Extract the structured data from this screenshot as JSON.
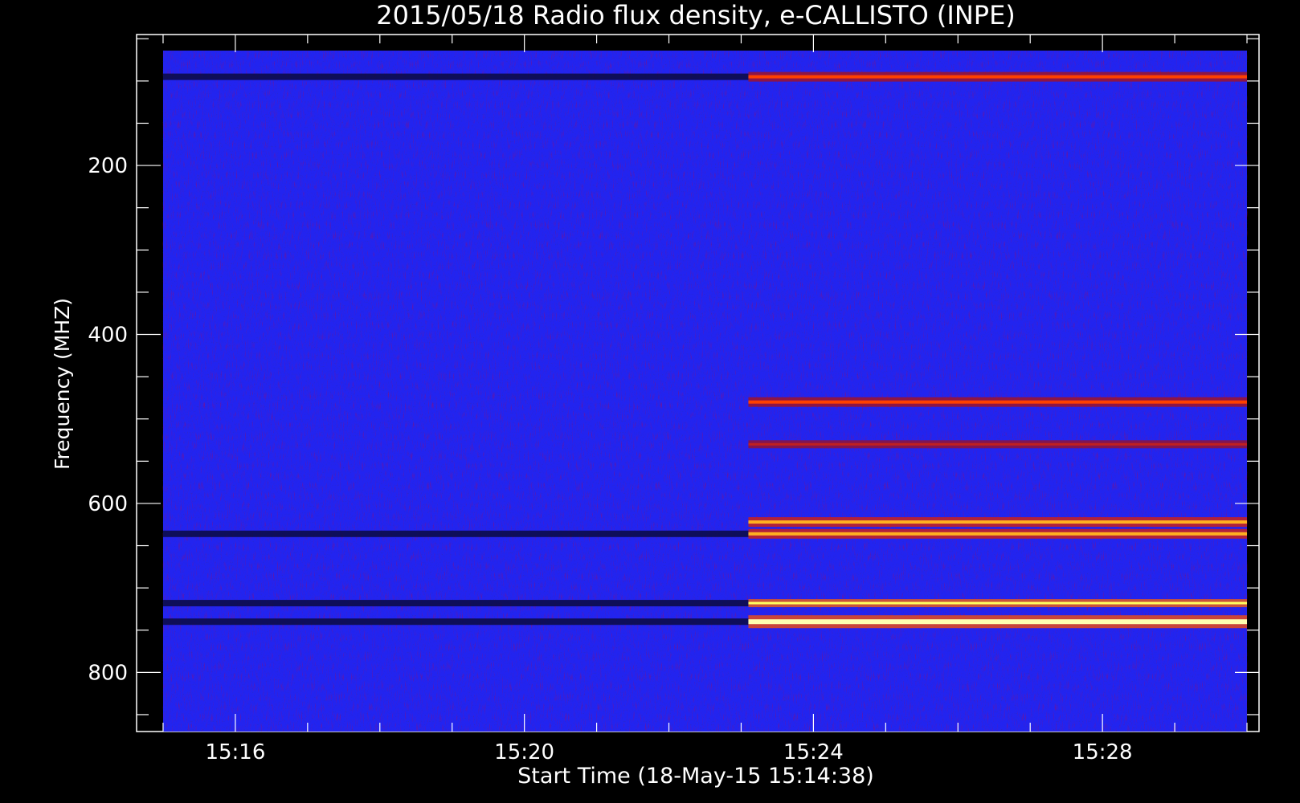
{
  "chart_data": {
    "type": "heatmap",
    "title": "2015/05/18  Radio flux density, e-CALLISTO (INPE)",
    "xlabel": "Start Time (18-May-15 15:14:38)",
    "ylabel": "Frequency (MHZ)",
    "x_ticks": [
      "15:16",
      "15:20",
      "15:24",
      "15:28"
    ],
    "x_tick_values_min": [
      16,
      20,
      24,
      28
    ],
    "y_ticks": [
      "200",
      "400",
      "600",
      "800"
    ],
    "y_tick_values": [
      200,
      400,
      600,
      800
    ],
    "xlim": [
      "15:14:38",
      "15:30:10"
    ],
    "ylim": [
      45,
      870
    ],
    "data_xlim_min": [
      15,
      30
    ],
    "data_ylim": [
      45,
      870
    ],
    "y_inverted": true,
    "colorscale": [
      "#0a0a3a",
      "#2020ff",
      "#b0101a",
      "#ff3000",
      "#ffff40"
    ],
    "background_color": "#2224f0",
    "change_time_min": 23.1,
    "emission_bands": [
      {
        "freq_mhz": 95,
        "intensity": "moderate",
        "phase": "after"
      },
      {
        "freq_mhz": 480,
        "intensity": "moderate",
        "phase": "after"
      },
      {
        "freq_mhz": 530,
        "intensity": "weak",
        "phase": "after"
      },
      {
        "freq_mhz": 622,
        "intensity": "strong",
        "phase": "after"
      },
      {
        "freq_mhz": 636,
        "intensity": "strong",
        "phase": "after"
      },
      {
        "freq_mhz": 718,
        "intensity": "very strong",
        "phase": "after"
      },
      {
        "freq_mhz": 740,
        "intensity": "saturated",
        "phase": "after"
      }
    ],
    "absorption_bands": [
      {
        "freq_mhz": 95,
        "phase": "before"
      },
      {
        "freq_mhz": 636,
        "phase": "before"
      },
      {
        "freq_mhz": 718,
        "phase": "before"
      },
      {
        "freq_mhz": 740,
        "phase": "before"
      }
    ],
    "grid": false,
    "legend": "none"
  }
}
